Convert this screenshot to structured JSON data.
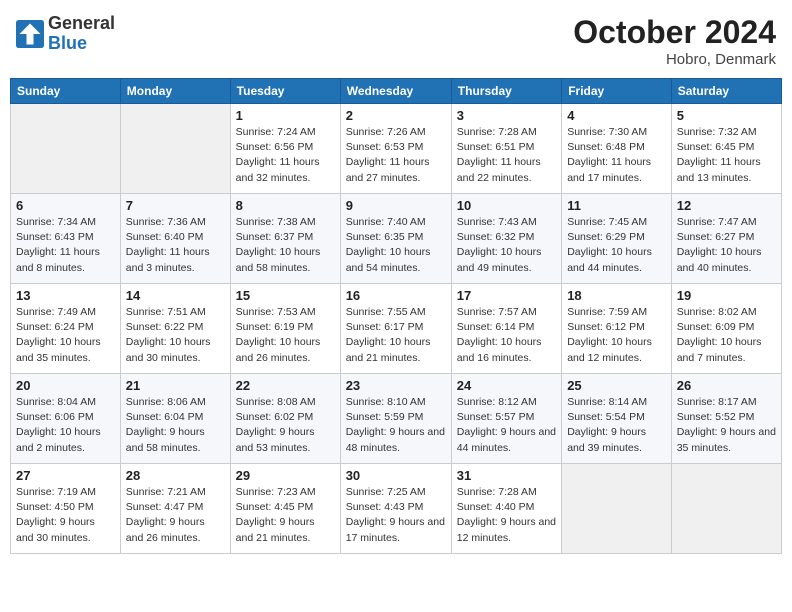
{
  "header": {
    "logo_general": "General",
    "logo_blue": "Blue",
    "month_title": "October 2024",
    "location": "Hobro, Denmark"
  },
  "days_of_week": [
    "Sunday",
    "Monday",
    "Tuesday",
    "Wednesday",
    "Thursday",
    "Friday",
    "Saturday"
  ],
  "weeks": [
    [
      {
        "day": "",
        "sunrise": "",
        "sunset": "",
        "daylight": ""
      },
      {
        "day": "",
        "sunrise": "",
        "sunset": "",
        "daylight": ""
      },
      {
        "day": "1",
        "sunrise": "Sunrise: 7:24 AM",
        "sunset": "Sunset: 6:56 PM",
        "daylight": "Daylight: 11 hours and 32 minutes."
      },
      {
        "day": "2",
        "sunrise": "Sunrise: 7:26 AM",
        "sunset": "Sunset: 6:53 PM",
        "daylight": "Daylight: 11 hours and 27 minutes."
      },
      {
        "day": "3",
        "sunrise": "Sunrise: 7:28 AM",
        "sunset": "Sunset: 6:51 PM",
        "daylight": "Daylight: 11 hours and 22 minutes."
      },
      {
        "day": "4",
        "sunrise": "Sunrise: 7:30 AM",
        "sunset": "Sunset: 6:48 PM",
        "daylight": "Daylight: 11 hours and 17 minutes."
      },
      {
        "day": "5",
        "sunrise": "Sunrise: 7:32 AM",
        "sunset": "Sunset: 6:45 PM",
        "daylight": "Daylight: 11 hours and 13 minutes."
      }
    ],
    [
      {
        "day": "6",
        "sunrise": "Sunrise: 7:34 AM",
        "sunset": "Sunset: 6:43 PM",
        "daylight": "Daylight: 11 hours and 8 minutes."
      },
      {
        "day": "7",
        "sunrise": "Sunrise: 7:36 AM",
        "sunset": "Sunset: 6:40 PM",
        "daylight": "Daylight: 11 hours and 3 minutes."
      },
      {
        "day": "8",
        "sunrise": "Sunrise: 7:38 AM",
        "sunset": "Sunset: 6:37 PM",
        "daylight": "Daylight: 10 hours and 58 minutes."
      },
      {
        "day": "9",
        "sunrise": "Sunrise: 7:40 AM",
        "sunset": "Sunset: 6:35 PM",
        "daylight": "Daylight: 10 hours and 54 minutes."
      },
      {
        "day": "10",
        "sunrise": "Sunrise: 7:43 AM",
        "sunset": "Sunset: 6:32 PM",
        "daylight": "Daylight: 10 hours and 49 minutes."
      },
      {
        "day": "11",
        "sunrise": "Sunrise: 7:45 AM",
        "sunset": "Sunset: 6:29 PM",
        "daylight": "Daylight: 10 hours and 44 minutes."
      },
      {
        "day": "12",
        "sunrise": "Sunrise: 7:47 AM",
        "sunset": "Sunset: 6:27 PM",
        "daylight": "Daylight: 10 hours and 40 minutes."
      }
    ],
    [
      {
        "day": "13",
        "sunrise": "Sunrise: 7:49 AM",
        "sunset": "Sunset: 6:24 PM",
        "daylight": "Daylight: 10 hours and 35 minutes."
      },
      {
        "day": "14",
        "sunrise": "Sunrise: 7:51 AM",
        "sunset": "Sunset: 6:22 PM",
        "daylight": "Daylight: 10 hours and 30 minutes."
      },
      {
        "day": "15",
        "sunrise": "Sunrise: 7:53 AM",
        "sunset": "Sunset: 6:19 PM",
        "daylight": "Daylight: 10 hours and 26 minutes."
      },
      {
        "day": "16",
        "sunrise": "Sunrise: 7:55 AM",
        "sunset": "Sunset: 6:17 PM",
        "daylight": "Daylight: 10 hours and 21 minutes."
      },
      {
        "day": "17",
        "sunrise": "Sunrise: 7:57 AM",
        "sunset": "Sunset: 6:14 PM",
        "daylight": "Daylight: 10 hours and 16 minutes."
      },
      {
        "day": "18",
        "sunrise": "Sunrise: 7:59 AM",
        "sunset": "Sunset: 6:12 PM",
        "daylight": "Daylight: 10 hours and 12 minutes."
      },
      {
        "day": "19",
        "sunrise": "Sunrise: 8:02 AM",
        "sunset": "Sunset: 6:09 PM",
        "daylight": "Daylight: 10 hours and 7 minutes."
      }
    ],
    [
      {
        "day": "20",
        "sunrise": "Sunrise: 8:04 AM",
        "sunset": "Sunset: 6:06 PM",
        "daylight": "Daylight: 10 hours and 2 minutes."
      },
      {
        "day": "21",
        "sunrise": "Sunrise: 8:06 AM",
        "sunset": "Sunset: 6:04 PM",
        "daylight": "Daylight: 9 hours and 58 minutes."
      },
      {
        "day": "22",
        "sunrise": "Sunrise: 8:08 AM",
        "sunset": "Sunset: 6:02 PM",
        "daylight": "Daylight: 9 hours and 53 minutes."
      },
      {
        "day": "23",
        "sunrise": "Sunrise: 8:10 AM",
        "sunset": "Sunset: 5:59 PM",
        "daylight": "Daylight: 9 hours and 48 minutes."
      },
      {
        "day": "24",
        "sunrise": "Sunrise: 8:12 AM",
        "sunset": "Sunset: 5:57 PM",
        "daylight": "Daylight: 9 hours and 44 minutes."
      },
      {
        "day": "25",
        "sunrise": "Sunrise: 8:14 AM",
        "sunset": "Sunset: 5:54 PM",
        "daylight": "Daylight: 9 hours and 39 minutes."
      },
      {
        "day": "26",
        "sunrise": "Sunrise: 8:17 AM",
        "sunset": "Sunset: 5:52 PM",
        "daylight": "Daylight: 9 hours and 35 minutes."
      }
    ],
    [
      {
        "day": "27",
        "sunrise": "Sunrise: 7:19 AM",
        "sunset": "Sunset: 4:50 PM",
        "daylight": "Daylight: 9 hours and 30 minutes."
      },
      {
        "day": "28",
        "sunrise": "Sunrise: 7:21 AM",
        "sunset": "Sunset: 4:47 PM",
        "daylight": "Daylight: 9 hours and 26 minutes."
      },
      {
        "day": "29",
        "sunrise": "Sunrise: 7:23 AM",
        "sunset": "Sunset: 4:45 PM",
        "daylight": "Daylight: 9 hours and 21 minutes."
      },
      {
        "day": "30",
        "sunrise": "Sunrise: 7:25 AM",
        "sunset": "Sunset: 4:43 PM",
        "daylight": "Daylight: 9 hours and 17 minutes."
      },
      {
        "day": "31",
        "sunrise": "Sunrise: 7:28 AM",
        "sunset": "Sunset: 4:40 PM",
        "daylight": "Daylight: 9 hours and 12 minutes."
      },
      {
        "day": "",
        "sunrise": "",
        "sunset": "",
        "daylight": ""
      },
      {
        "day": "",
        "sunrise": "",
        "sunset": "",
        "daylight": ""
      }
    ]
  ]
}
